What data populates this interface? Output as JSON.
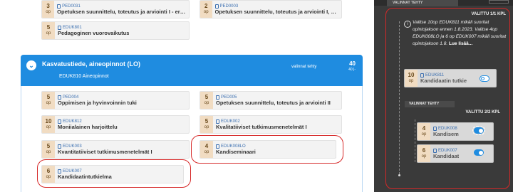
{
  "top_courses": [
    {
      "credits": "3",
      "unit": "op",
      "code": "PED0031",
      "name": "Opetuksen suunnittelu, toteutus ja arviointi I - eriytyv"
    },
    {
      "credits": "2",
      "unit": "op",
      "code": "PED0003",
      "name": "Opetuksen suunnittelu, toteutus ja arviointi I, yhteiso"
    },
    {
      "credits": "5",
      "unit": "op",
      "code": "EDUK801",
      "name": "Pedagoginen vuorovaikutus"
    }
  ],
  "module": {
    "title": "Kasvatustiede, aineopinnot (LO)",
    "subtitle": "EDUK810 Aineopinnot",
    "selection_status": "valinnat tehty",
    "credits": "40",
    "credits_unit": "40 |-"
  },
  "module_courses": [
    {
      "credits": "5",
      "unit": "op",
      "code": "PED004",
      "name": "Oppimisen ja hyvinvoinnin tuki"
    },
    {
      "credits": "5",
      "unit": "op",
      "code": "PED005",
      "name": "Opetuksen suunnittelu, toteutus ja arviointi II"
    },
    {
      "credits": "10",
      "unit": "op",
      "code": "EDUK812",
      "name": "Moniialainen harjoittelu"
    },
    {
      "credits": "5",
      "unit": "op",
      "code": "EDUK002",
      "name": "Kvalitatiiviset tutkimusmenetelmät I"
    },
    {
      "credits": "5",
      "unit": "op",
      "code": "EDUK003",
      "name": "Kvantitatiiviset tutkimusmenetelmät I"
    },
    {
      "credits": "4",
      "unit": "op",
      "code": "EDUK008LO",
      "name": "Kandiseminaari"
    },
    {
      "credits": "6",
      "unit": "op",
      "code": "EDUK007",
      "name": "Kandidaatintutkielma"
    }
  ],
  "sidebar": {
    "header": "VALINNAT TEHTY",
    "selected_1": "VALITTU 1/1 KPL",
    "info_text": "Valitse 10op EDUK811 mikäli suoritat opintojakson ennen 1.8.2023. Valitse 4op EDUK008LO ja 6 op EDUK007 mikäli suoritat opintojakson 1.8.",
    "read_more": "Lue lisää...",
    "course_1": {
      "credits": "10",
      "unit": "op",
      "code": "EDUK811",
      "name": "Kandidaatin tutkie"
    },
    "group_header": "VALINNAT TEHTY",
    "selected_2": "VALITTU 2/2 KPL",
    "course_2": {
      "credits": "4",
      "unit": "op",
      "code": "EDUK008",
      "name": "Kandisem"
    },
    "course_3": {
      "credits": "6",
      "unit": "op",
      "code": "EDUK007",
      "name": "Kandidaat"
    }
  }
}
